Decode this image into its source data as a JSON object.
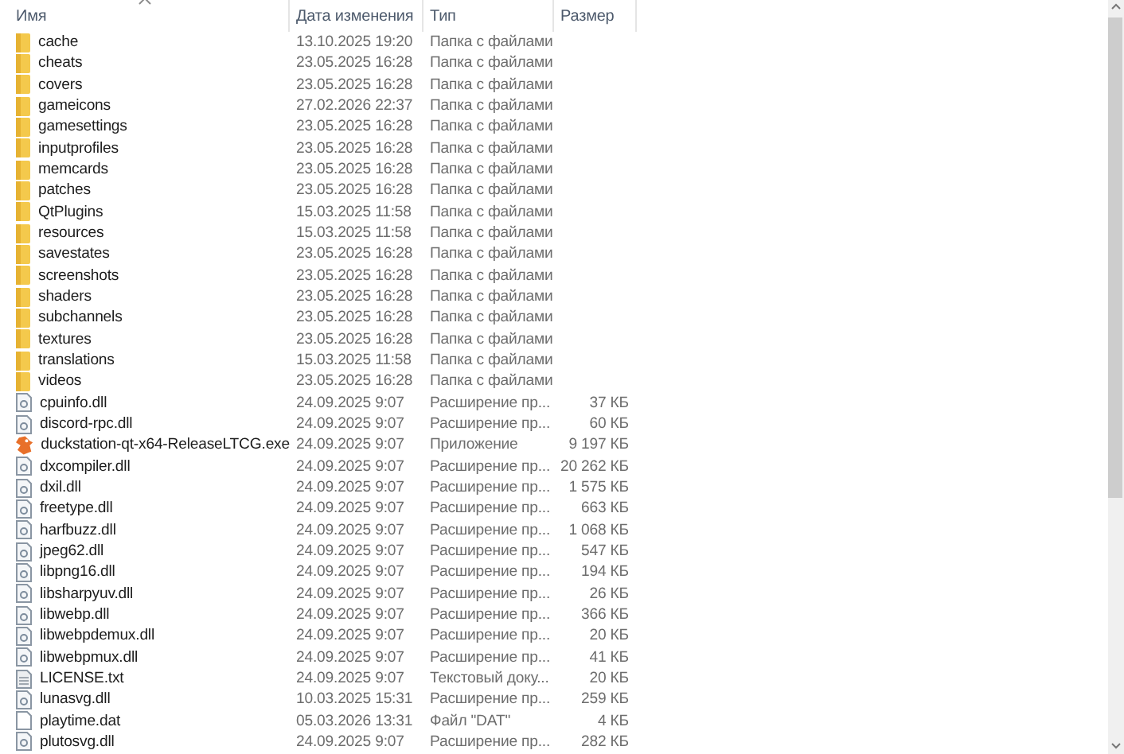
{
  "columns": [
    {
      "label": "Имя",
      "sorted": true
    },
    {
      "label": "Дата изменения",
      "sorted": false
    },
    {
      "label": "Тип",
      "sorted": false
    },
    {
      "label": "Размер",
      "sorted": false
    }
  ],
  "rows": [
    {
      "kind": "folder",
      "name": "cache",
      "date": "13.10.2025 19:20",
      "type": "Папка с файлами"
    },
    {
      "kind": "folder",
      "name": "cheats",
      "date": "23.05.2025 16:28",
      "type": "Папка с файлами"
    },
    {
      "kind": "folder",
      "name": "covers",
      "date": "23.05.2025 16:28",
      "type": "Папка с файлами"
    },
    {
      "kind": "folder",
      "name": "gameicons",
      "date": "27.02.2026 22:37",
      "type": "Папка с файлами"
    },
    {
      "kind": "folder",
      "name": "gamesettings",
      "date": "23.05.2025 16:28",
      "type": "Папка с файлами"
    },
    {
      "kind": "folder",
      "name": "inputprofiles",
      "date": "23.05.2025 16:28",
      "type": "Папка с файлами"
    },
    {
      "kind": "folder",
      "name": "memcards",
      "date": "23.05.2025 16:28",
      "type": "Папка с файлами"
    },
    {
      "kind": "folder",
      "name": "patches",
      "date": "23.05.2025 16:28",
      "type": "Папка с файлами"
    },
    {
      "kind": "folder",
      "name": "QtPlugins",
      "date": "15.03.2025 11:58",
      "type": "Папка с файлами"
    },
    {
      "kind": "folder",
      "name": "resources",
      "date": "15.03.2025 11:58",
      "type": "Папка с файлами"
    },
    {
      "kind": "folder",
      "name": "savestates",
      "date": "23.05.2025 16:28",
      "type": "Папка с файлами"
    },
    {
      "kind": "folder",
      "name": "screenshots",
      "date": "23.05.2025 16:28",
      "type": "Папка с файлами"
    },
    {
      "kind": "folder",
      "name": "shaders",
      "date": "23.05.2025 16:28",
      "type": "Папка с файлами"
    },
    {
      "kind": "folder",
      "name": "subchannels",
      "date": "23.05.2025 16:28",
      "type": "Папка с файлами"
    },
    {
      "kind": "folder",
      "name": "textures",
      "date": "23.05.2025 16:28",
      "type": "Папка с файлами"
    },
    {
      "kind": "folder",
      "name": "translations",
      "date": "15.03.2025 11:58",
      "type": "Папка с файлами"
    },
    {
      "kind": "folder",
      "name": "videos",
      "date": "23.05.2025 16:28",
      "type": "Папка с файлами"
    },
    {
      "kind": "dll",
      "name": "cpuinfo.dll",
      "date": "24.09.2025 9:07",
      "type": "Расширение пр...",
      "size": "37 КБ"
    },
    {
      "kind": "dll",
      "name": "discord-rpc.dll",
      "date": "24.09.2025 9:07",
      "type": "Расширение пр...",
      "size": "60 КБ"
    },
    {
      "kind": "exe",
      "name": "duckstation-qt-x64-ReleaseLTCG.exe",
      "date": "24.09.2025 9:07",
      "type": "Приложение",
      "size": "9 197 КБ"
    },
    {
      "kind": "dll",
      "name": "dxcompiler.dll",
      "date": "24.09.2025 9:07",
      "type": "Расширение пр...",
      "size": "20 262 КБ"
    },
    {
      "kind": "dll",
      "name": "dxil.dll",
      "date": "24.09.2025 9:07",
      "type": "Расширение пр...",
      "size": "1 575 КБ"
    },
    {
      "kind": "dll",
      "name": "freetype.dll",
      "date": "24.09.2025 9:07",
      "type": "Расширение пр...",
      "size": "663 КБ"
    },
    {
      "kind": "dll",
      "name": "harfbuzz.dll",
      "date": "24.09.2025 9:07",
      "type": "Расширение пр...",
      "size": "1 068 КБ"
    },
    {
      "kind": "dll",
      "name": "jpeg62.dll",
      "date": "24.09.2025 9:07",
      "type": "Расширение пр...",
      "size": "547 КБ"
    },
    {
      "kind": "dll",
      "name": "libpng16.dll",
      "date": "24.09.2025 9:07",
      "type": "Расширение пр...",
      "size": "194 КБ"
    },
    {
      "kind": "dll",
      "name": "libsharpyuv.dll",
      "date": "24.09.2025 9:07",
      "type": "Расширение пр...",
      "size": "26 КБ"
    },
    {
      "kind": "dll",
      "name": "libwebp.dll",
      "date": "24.09.2025 9:07",
      "type": "Расширение пр...",
      "size": "366 КБ"
    },
    {
      "kind": "dll",
      "name": "libwebpdemux.dll",
      "date": "24.09.2025 9:07",
      "type": "Расширение пр...",
      "size": "20 КБ"
    },
    {
      "kind": "dll",
      "name": "libwebpmux.dll",
      "date": "24.09.2025 9:07",
      "type": "Расширение пр...",
      "size": "41 КБ"
    },
    {
      "kind": "txt",
      "name": "LICENSE.txt",
      "date": "24.09.2025 9:07",
      "type": "Текстовый доку...",
      "size": "20 КБ"
    },
    {
      "kind": "dll",
      "name": "lunasvg.dll",
      "date": "10.03.2025 15:31",
      "type": "Расширение пр...",
      "size": "259 КБ"
    },
    {
      "kind": "dat",
      "name": "playtime.dat",
      "date": "05.03.2026 13:31",
      "type": "Файл \"DAT\"",
      "size": "4 КБ"
    },
    {
      "kind": "dll",
      "name": "plutosvg.dll",
      "date": "24.09.2025 9:07",
      "type": "Расширение пр...",
      "size": "282 КБ"
    }
  ]
}
